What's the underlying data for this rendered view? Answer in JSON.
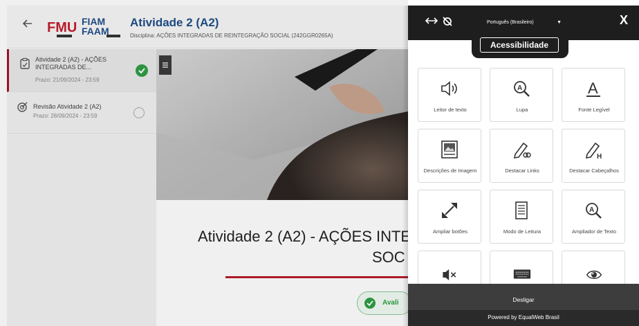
{
  "header": {
    "back_icon": "arrow-left-icon",
    "logo_fmu": "FMU",
    "logo_fiam": "FIAM",
    "logo_faam": "FAAM",
    "title": "Atividade 2 (A2)",
    "subtitle": "Disciplina: AÇÕES INTEGRADAS DE REINTEGRAÇÃO SOCIAL (242GGR0265A)"
  },
  "sidebar": {
    "items": [
      {
        "label": "Atividade 2 (A2) - AÇÕES INTEGRADAS DE...",
        "due": "Prazo: 21/09/2024 - 23:59",
        "status": "done"
      },
      {
        "label": "Revisão Atividade 2 (A2)",
        "due": "Prazo: 28/09/2024 - 23:59",
        "status": "todo"
      }
    ]
  },
  "main": {
    "menu_icon": "hamburger-icon",
    "title_line1": "Atividade 2 (A2) - AÇÕES INTE",
    "title_line2": "SOC",
    "status_label": "Avali"
  },
  "accessibility": {
    "language": "Português (Brasileiro)",
    "close": "X",
    "tab_label": "Acessibilidade",
    "cards": [
      {
        "label": "Leitor de texto",
        "icon": "speaker-icon"
      },
      {
        "label": "Lupa",
        "icon": "magnifier-icon"
      },
      {
        "label": "Fonte Legível",
        "icon": "font-icon"
      },
      {
        "label": "Descrições de Imagem",
        "icon": "image-icon"
      },
      {
        "label": "Destacar Links",
        "icon": "highlight-links-icon"
      },
      {
        "label": "Destacar Cabeçalhos",
        "icon": "highlight-headers-icon"
      },
      {
        "label": "Ampliar botões",
        "icon": "expand-icon"
      },
      {
        "label": "Modo de Leitura",
        "icon": "document-icon"
      },
      {
        "label": "Ampliador de Texto",
        "icon": "text-magnifier-icon"
      },
      {
        "label": "",
        "icon": "mute-icon"
      },
      {
        "label": "",
        "icon": "keyboard-icon"
      },
      {
        "label": "",
        "icon": "eye-icon"
      }
    ],
    "disable_label": "Desligar",
    "powered_by": "Powered by EqualWeb Brasil"
  },
  "colors": {
    "brand_blue": "#1f4e8a",
    "brand_red": "#b71c2b",
    "success_green": "#2f9e44",
    "panel_dark": "#1e1e1e"
  }
}
